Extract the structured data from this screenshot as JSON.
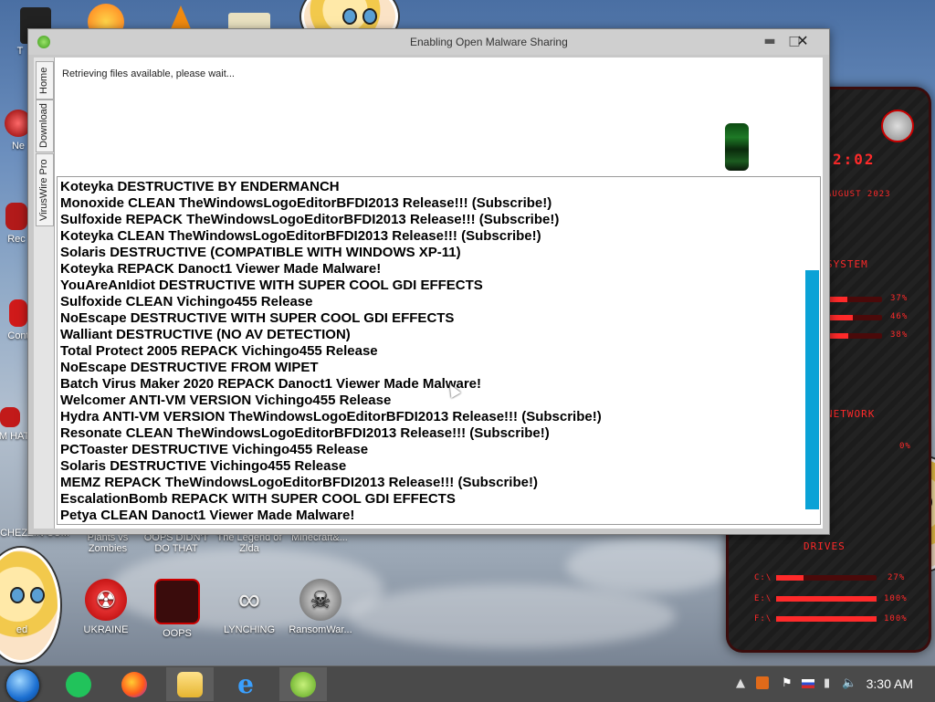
{
  "window": {
    "title": "Enabling Open Malware Sharing",
    "minimize_glyph": "▬",
    "maximize_glyph": "□",
    "close_glyph": "✕",
    "tabs": [
      "Home",
      "Download",
      "VirusWire Pro"
    ],
    "status": "Retrieving files available, please wait...",
    "files": [
      "Koteyka DESTRUCTIVE BY ENDERMANCH",
      "Monoxide CLEAN TheWindowsLogoEditorBFDI2013 Release!!! (Subscribe!)",
      "Sulfoxide REPACK TheWindowsLogoEditorBFDI2013 Release!!! (Subscribe!)",
      "Koteyka CLEAN TheWindowsLogoEditorBFDI2013 Release!!! (Subscribe!)",
      "Solaris DESTRUCTIVE (COMPATIBLE WITH WINDOWS XP-11)",
      "Koteyka REPACK Danoct1 Viewer Made Malware!",
      "YouAreAnIdiot DESTRUCTIVE WITH SUPER COOL GDI EFFECTS",
      "Sulfoxide CLEAN Vichingo455 Release",
      "NoEscape DESTRUCTIVE WITH SUPER COOL GDI EFFECTS",
      "Walliant DESTRUCTIVE (NO AV DETECTION)",
      "Total Protect 2005 REPACK Vichingo455 Release",
      "NoEscape DESTRUCTIVE FROM WIPET",
      "Batch Virus Maker 2020 REPACK Danoct1 Viewer Made Malware!",
      "Welcomer ANTI-VM VERSION Vichingo455 Release",
      "Hydra ANTI-VM VERSION TheWindowsLogoEditorBFDI2013 Release!!! (Subscribe!)",
      "Resonate CLEAN TheWindowsLogoEditorBFDI2013 Release!!! (Subscribe!)",
      "PCToaster DESTRUCTIVE Vichingo455 Release",
      "Solaris DESTRUCTIVE Vichingo455 Release",
      "MEMZ REPACK TheWindowsLogoEditorBFDI2013 Release!!! (Subscribe!)",
      "EscalationBomb REPACK WITH SUPER COOL GDI EFFECTS",
      "Petya CLEAN Danoct1 Viewer Made Malware!"
    ]
  },
  "desktop_icons": {
    "ukraine": "UKRAINE",
    "oops": "OOPS",
    "lynching": "LYNCHING",
    "ransomware": "RansomWar...",
    "plants": "Plants vs Zombies",
    "oops_didnt": "OOPS DIDN'T DO THAT",
    "zelda": "The Legend of Zlda",
    "minecraft": "Minecraft&...",
    "chezzin": "CHEZZIN CUM",
    "left_ne": "Ne",
    "left_rec": "Rec",
    "left_cont": "Cont",
    "left_t": "T",
    "left_com": "COM HATE",
    "left_ed": "ed"
  },
  "widget": {
    "clock": "2:02",
    "date": "AUGUST 2023",
    "system_label": "SYSTEM",
    "cpu_pct": "37%",
    "ram_pct": "46%",
    "swap_pct": "38%",
    "network_label": "NETWORK",
    "network_val": "0%",
    "drives_label": "DRIVES",
    "drive_c": "C:\\",
    "drive_c_pct": "27%",
    "drive_e": "E:\\",
    "drive_e_pct": "100%",
    "drive_f": "F:\\",
    "drive_f_pct": "100%",
    "cpu_level": 0.37,
    "ram_level": 0.46,
    "swap_level": 0.38,
    "drive_c_level": 0.27,
    "drive_e_level": 1.0,
    "drive_f_level": 1.0
  },
  "taskbar": {
    "clock": "3:30 AM"
  },
  "colors": {
    "scroll_thumb": "#0aa2d6",
    "widget_red": "#ff2a2a"
  }
}
